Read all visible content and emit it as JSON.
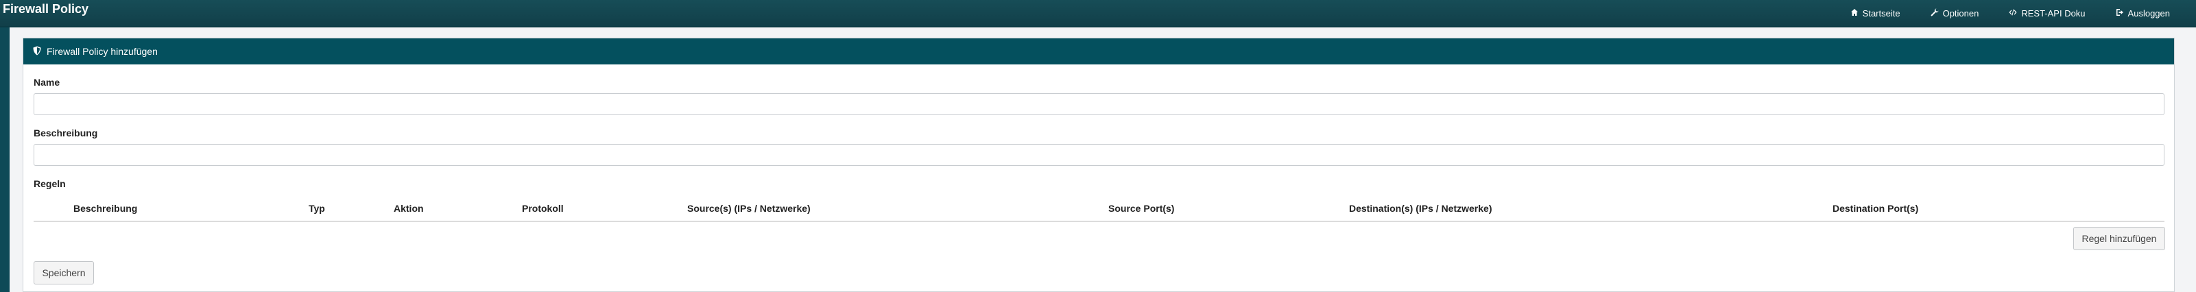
{
  "app": {
    "title": "Firewall Policy"
  },
  "nav": {
    "items": [
      {
        "label": "Startseite",
        "icon": "home-icon"
      },
      {
        "label": "Optionen",
        "icon": "wrench-icon"
      },
      {
        "label": "REST-API Doku",
        "icon": "code-icon"
      },
      {
        "label": "Ausloggen",
        "icon": "logout-icon"
      }
    ]
  },
  "card": {
    "title": "Firewall Policy hinzufügen",
    "icon": "shield-icon",
    "header_color": "#04505e"
  },
  "form": {
    "name_label": "Name",
    "name_value": "",
    "description_label": "Beschreibung",
    "description_value": "",
    "rules_label": "Regeln"
  },
  "rules_table": {
    "columns": [
      "Beschreibung",
      "Typ",
      "Aktion",
      "Protokoll",
      "Source(s) (IPs / Netzwerke)",
      "Source Port(s)",
      "Destination(s) (IPs / Netzwerke)",
      "Destination Port(s)"
    ],
    "rows": []
  },
  "buttons": {
    "add_rule": "Regel hinzufügen",
    "save": "Speichern"
  }
}
